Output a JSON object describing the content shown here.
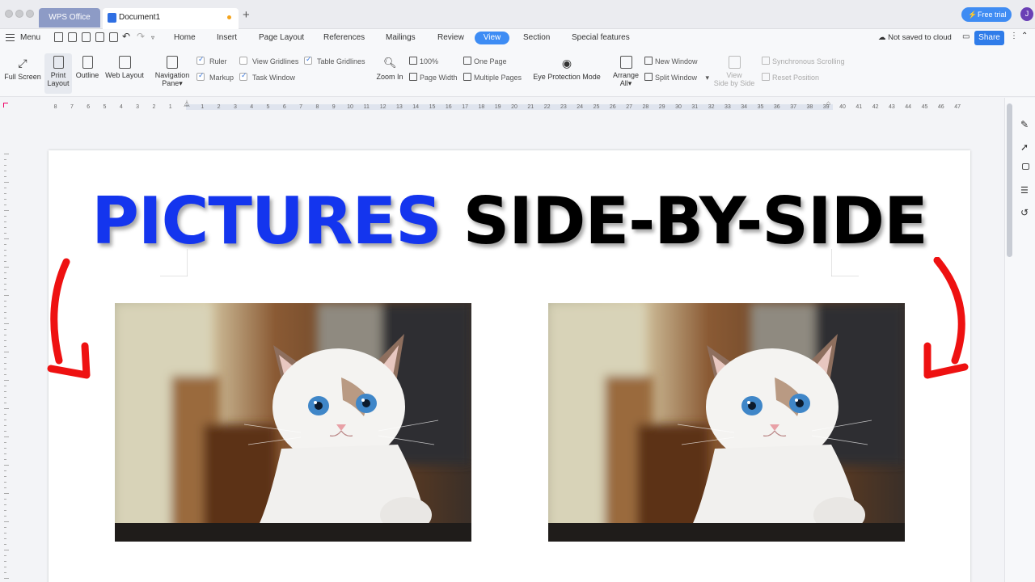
{
  "window": {
    "app_tab": "WPS Office",
    "doc_tab": "Document1",
    "new_tab": "+",
    "free_trial": "Free trial",
    "avatar_letter": "J"
  },
  "menubar": {
    "menu_label": "Menu",
    "tabs": [
      "Home",
      "Insert",
      "Page Layout",
      "References",
      "Mailings",
      "Review",
      "View",
      "Section",
      "Special features"
    ],
    "active_tab": "View",
    "cloud_status": "Not saved to cloud",
    "share": "Share"
  },
  "ribbon": {
    "full_screen": "Full Screen",
    "print_layout": [
      "Print",
      "Layout"
    ],
    "outline": "Outline",
    "web_layout": "Web Layout",
    "navigation_pane": [
      "Navigation",
      "Pane"
    ],
    "ruler": {
      "label": "Ruler",
      "checked": true
    },
    "markup": {
      "label": "Markup",
      "checked": true
    },
    "view_gridlines": {
      "label": "View Gridlines",
      "checked": false
    },
    "task_window": {
      "label": "Task Window",
      "checked": true
    },
    "table_gridlines": {
      "label": "Table Gridlines",
      "checked": true
    },
    "zoom_in": "Zoom In",
    "zoom_100": "100%",
    "page_width": "Page Width",
    "one_page": "One Page",
    "multiple_pages": "Multiple Pages",
    "eye_protection": "Eye Protection Mode",
    "arrange_all": [
      "Arrange",
      "All"
    ],
    "new_window": "New Window",
    "split_window": "Split Window",
    "view_side_by_side": [
      "View",
      "Side by Side"
    ],
    "synchronous_scrolling": "Synchronous Scrolling",
    "reset_position": "Reset Position"
  },
  "ruler": {
    "left_numbers": [
      "8",
      "7",
      "6",
      "5",
      "4",
      "3",
      "2",
      "1"
    ],
    "right_numbers": [
      "1",
      "2",
      "3",
      "4",
      "5",
      "6",
      "7",
      "8",
      "9",
      "10",
      "11",
      "12",
      "13",
      "14",
      "15",
      "16",
      "17",
      "18",
      "19",
      "20",
      "21",
      "22",
      "23",
      "24",
      "25",
      "26",
      "27",
      "28",
      "29",
      "30",
      "31",
      "32",
      "33",
      "34",
      "35",
      "36",
      "37",
      "38",
      "39",
      "40",
      "41",
      "42",
      "43",
      "44",
      "45",
      "46",
      "47"
    ]
  },
  "document": {
    "headline_blue": "PICTURES",
    "headline_black": "SIDE-BY-SIDE"
  },
  "colors": {
    "accent": "#3d8cf4",
    "headline_blue": "#1435ee",
    "arrow_red": "#ee1111"
  }
}
